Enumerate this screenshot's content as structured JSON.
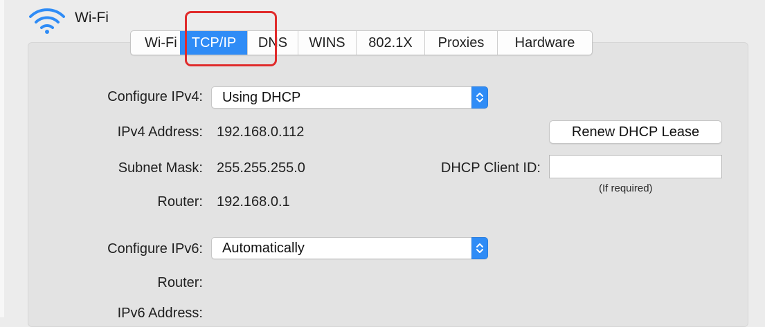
{
  "header": {
    "title": "Wi-Fi"
  },
  "tabs": [
    "Wi-Fi",
    "TCP/IP",
    "DNS",
    "WINS",
    "802.1X",
    "Proxies",
    "Hardware"
  ],
  "ipv4": {
    "configure_label": "Configure IPv4:",
    "configure_value": "Using DHCP",
    "address_label": "IPv4 Address:",
    "address_value": "192.168.0.112",
    "subnet_label": "Subnet Mask:",
    "subnet_value": "255.255.255.0",
    "router_label": "Router:",
    "router_value": "192.168.0.1"
  },
  "dhcp": {
    "renew_button": "Renew DHCP Lease",
    "client_id_label": "DHCP Client ID:",
    "client_id_value": "",
    "client_id_hint": "(If required)"
  },
  "ipv6": {
    "configure_label": "Configure IPv6:",
    "configure_value": "Automatically",
    "router_label": "Router:",
    "address_label": "IPv6 Address:"
  },
  "colors": {
    "accent": "#2f8cf6",
    "highlight": "#e02b2b",
    "panel": "#e3e3e3",
    "background": "#ececec"
  },
  "icons": {
    "wifi": "wifi-icon",
    "stepper": "chevron-up-down-icon"
  }
}
